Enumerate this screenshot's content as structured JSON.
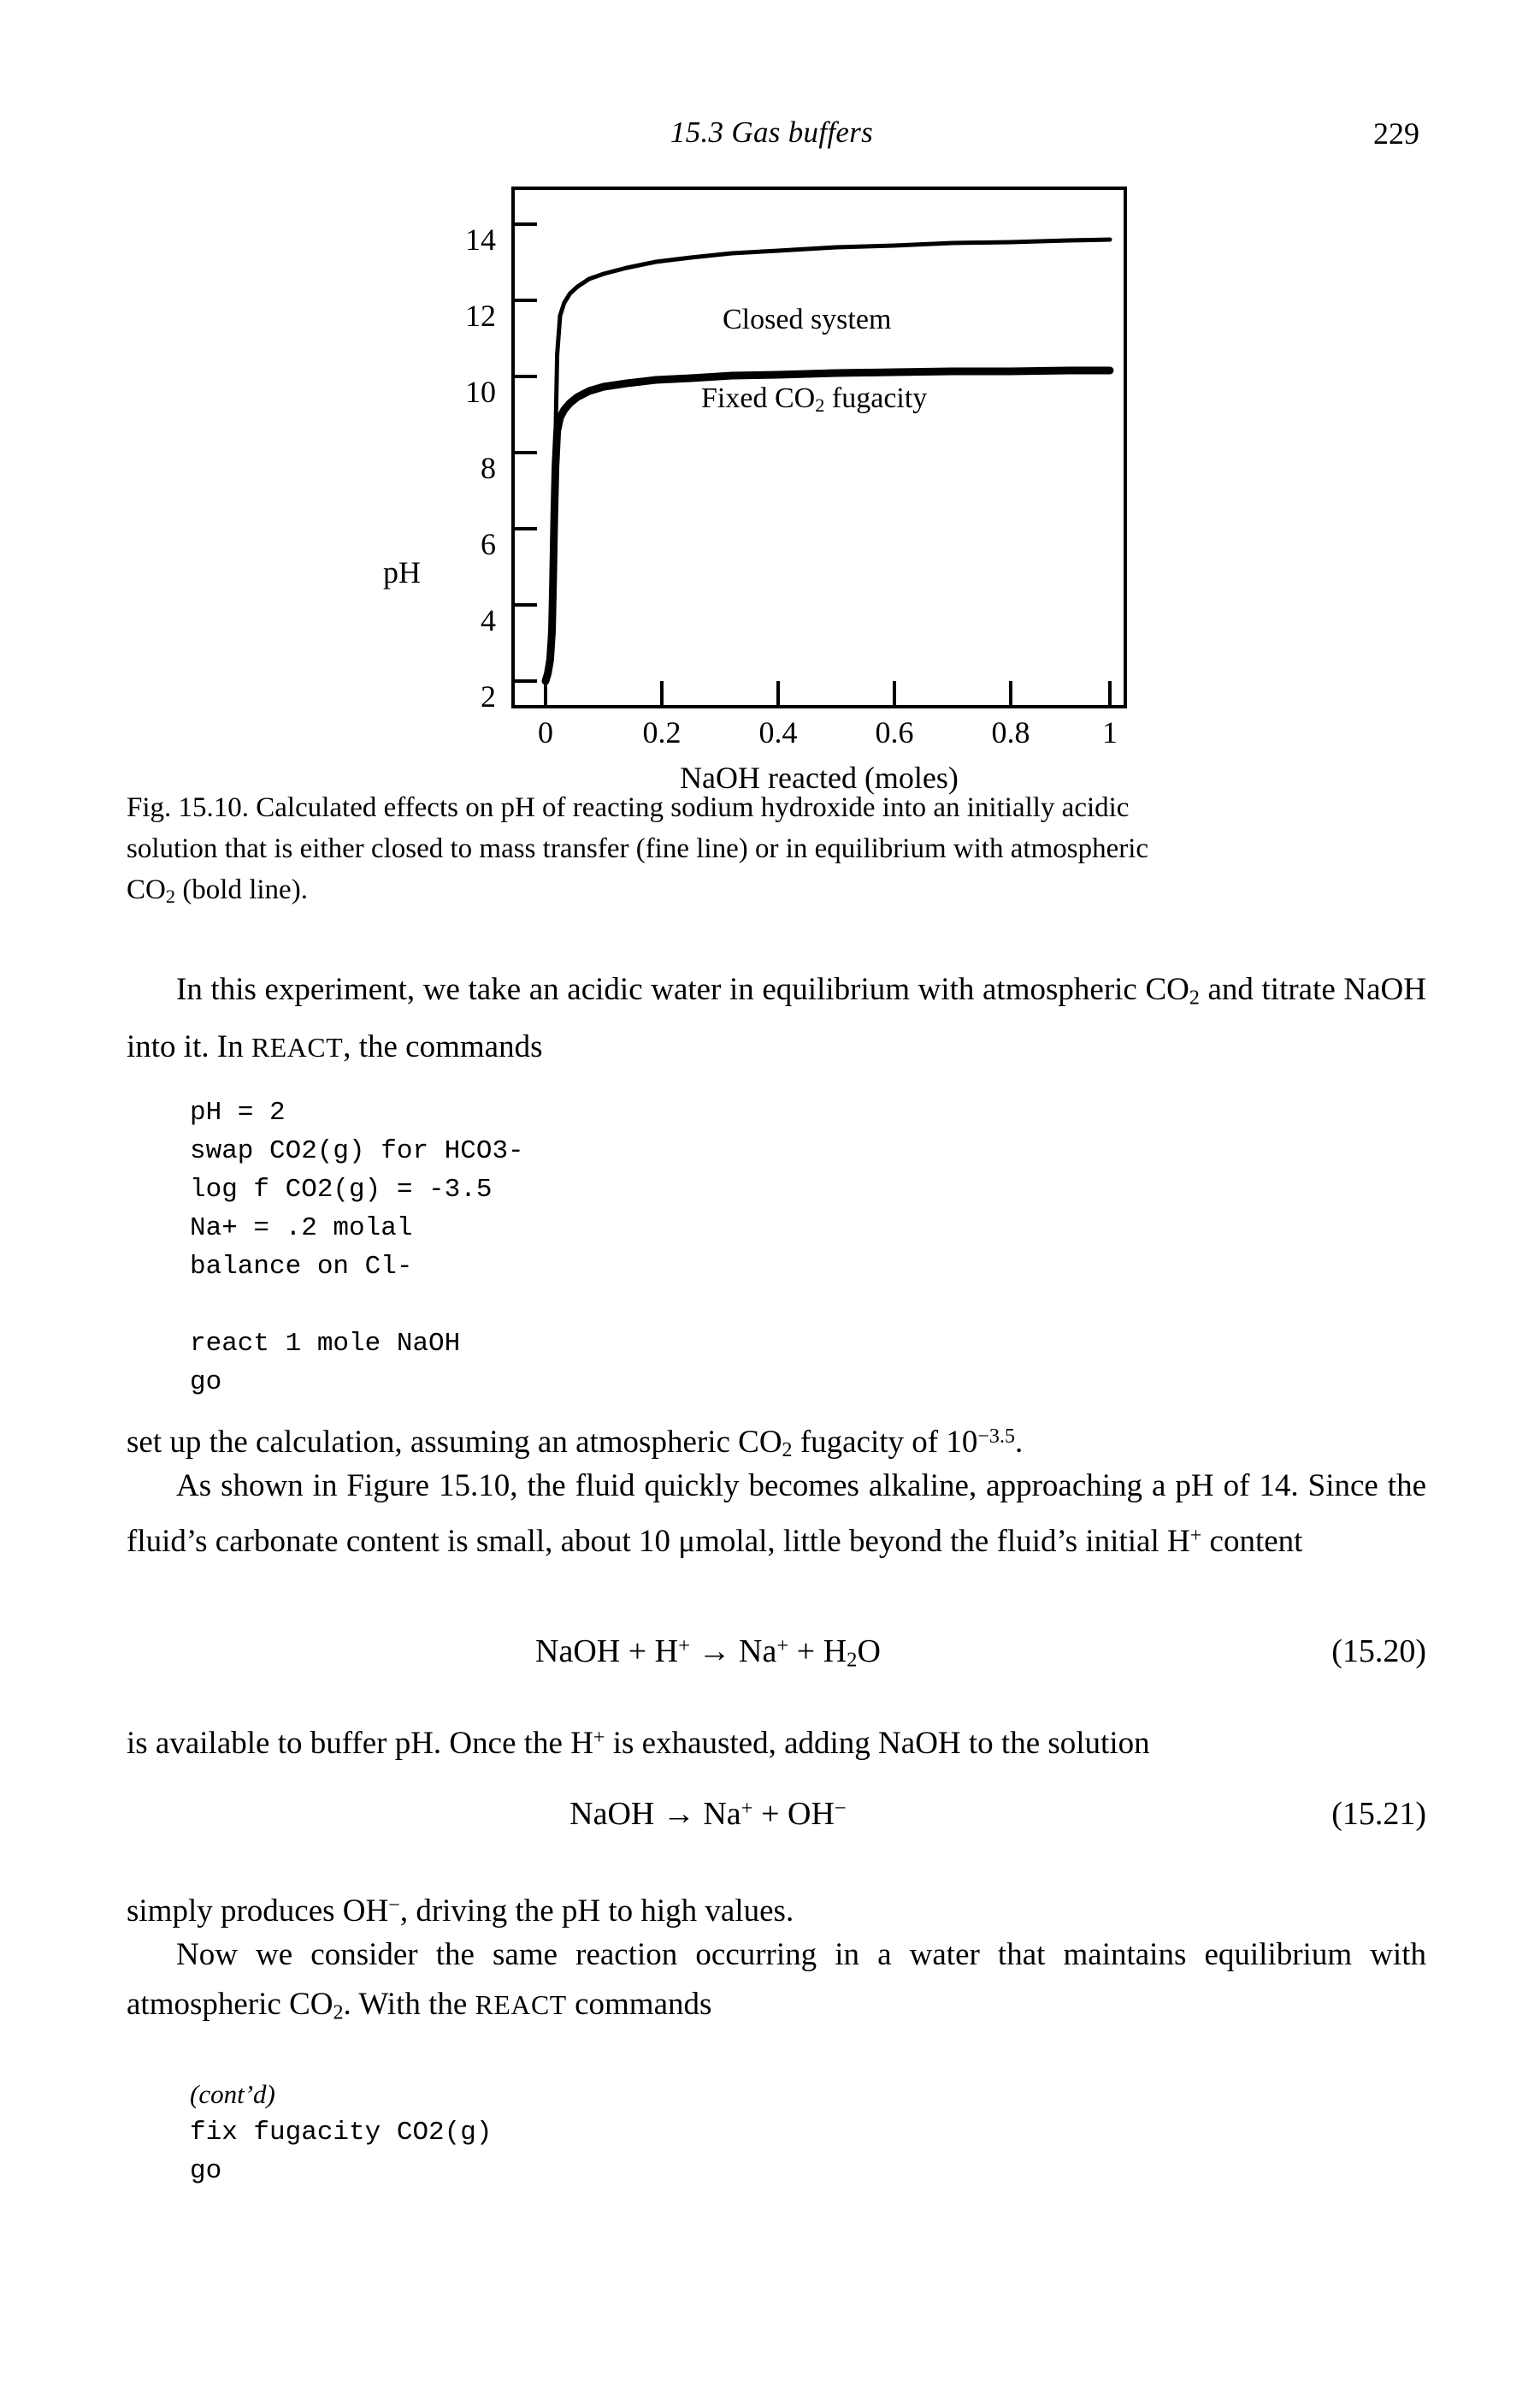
{
  "runhead": {
    "title": "15.3  Gas buffers",
    "page_number": "229"
  },
  "figure": {
    "caption_line1": "Fig. 15.10.  Calculated effects on pH of reacting sodium hydroxide into an initially acidic",
    "caption_line2": "solution that is either closed to mass transfer (fine line) or in equilibrium with atmospheric",
    "caption_line3_pre": "CO",
    "caption_line3_sub": "2",
    "caption_line3_post": " (bold line)."
  },
  "chart_data": {
    "type": "line",
    "title": "",
    "xlabel": "NaOH reacted (moles)",
    "ylabel": "pH",
    "xlim": [
      -0.03,
      1.06
    ],
    "ylim": [
      1.2,
      14.9
    ],
    "xticks": [
      0,
      0.2,
      0.4,
      0.6,
      0.8,
      1
    ],
    "xticklabels": [
      "0",
      "0.2",
      "0.4",
      "0.6",
      "0.8",
      "1"
    ],
    "yticks": [
      2,
      4,
      6,
      8,
      10,
      12,
      14
    ],
    "yticklabels": [
      "2",
      "4",
      "6",
      "8",
      "10",
      "12",
      "14"
    ],
    "grid": false,
    "legend_position": "inline-annotations",
    "annotations": [
      {
        "text": "Closed system",
        "x": 0.36,
        "y": 12.6
      },
      {
        "text": "Fixed CO2 fugacity",
        "x": 0.31,
        "y": 10.6
      }
    ],
    "series": [
      {
        "name": "Closed system",
        "style": "fine line",
        "x": [
          0.0,
          0.004,
          0.008,
          0.011,
          0.013,
          0.015,
          0.017,
          0.02,
          0.025,
          0.032,
          0.042,
          0.055,
          0.075,
          0.1,
          0.14,
          0.19,
          0.25,
          0.32,
          0.4,
          0.5,
          0.6,
          0.7,
          0.8,
          0.9,
          1.0
        ],
        "y": [
          2.0,
          2.2,
          2.55,
          3.3,
          4.6,
          6.3,
          8.3,
          10.6,
          11.6,
          11.95,
          12.18,
          12.37,
          12.57,
          12.72,
          12.88,
          13.02,
          13.14,
          13.24,
          13.32,
          13.4,
          13.46,
          13.51,
          13.55,
          13.58,
          13.61
        ]
      },
      {
        "name": "Fixed CO2 fugacity",
        "style": "bold line",
        "x": [
          0.0,
          0.004,
          0.008,
          0.011,
          0.013,
          0.015,
          0.017,
          0.02,
          0.025,
          0.032,
          0.042,
          0.055,
          0.075,
          0.1,
          0.14,
          0.19,
          0.25,
          0.32,
          0.4,
          0.5,
          0.6,
          0.7,
          0.8,
          0.9,
          1.0
        ],
        "y": [
          2.0,
          2.2,
          2.55,
          3.3,
          4.6,
          6.3,
          7.6,
          8.55,
          8.9,
          9.1,
          9.28,
          9.44,
          9.6,
          9.7,
          9.8,
          9.88,
          9.94,
          9.99,
          10.02,
          10.06,
          10.08,
          10.1,
          10.12,
          10.13,
          10.14
        ]
      }
    ]
  },
  "body": {
    "para1_a": "In this experiment, we take an acidic water in equilibrium with atmospheric CO",
    "para1_sub": "2",
    "para1_b": " and titrate NaOH into it. In ",
    "para1_react": "REACT",
    "para1_c": ", the commands",
    "code_block_1": "pH = 2\nswap CO2(g) for HCO3-\nlog f CO2(g) = -3.5\nNa+ = .2 molal\nbalance on Cl-\n\nreact 1 mole NaOH\ngo",
    "para2_a": "set up the calculation, assuming an atmospheric CO",
    "para2_sub": "2",
    "para2_b": " fugacity of 10",
    "para2_sup": "−3.5",
    "para2_c": ".",
    "para3_a": "As shown in Figure 15.10, the fluid quickly becomes alkaline, approaching a pH of 14. Since the fluid’s carbonate content is small, about 10 μmolal, little beyond the fluid’s initial H",
    "para3_sup": "+",
    "para3_b": " content",
    "eq1_body_a": "NaOH + H",
    "eq1_sup1": "+",
    "eq1_body_b": " → Na",
    "eq1_sup2": "+",
    "eq1_body_c": " + H",
    "eq1_sub": "2",
    "eq1_body_d": "O",
    "eq1_number": "(15.20)",
    "para4_a": "is available to buffer pH. Once the H",
    "para4_sup": "+",
    "para4_b": " is exhausted, adding NaOH to the solution",
    "eq2_body_a": "NaOH → Na",
    "eq2_sup1": "+",
    "eq2_body_b": " + OH",
    "eq2_sup2": "−",
    "eq2_number": "(15.21)",
    "para5_a": "simply produces OH",
    "para5_sup": "−",
    "para5_b": ", driving the pH to high values.",
    "para6_a": "Now we consider the same reaction occurring in a water that maintains equilibrium with atmospheric CO",
    "para6_sub": "2",
    "para6_b": ". With the ",
    "para6_react": "REACT",
    "para6_c": " commands",
    "code_block_2_note": "(cont’d)",
    "code_block_2": "fix fugacity CO2(g)\ngo"
  },
  "colors": {
    "ink": "#000000",
    "paper": "#ffffff"
  }
}
